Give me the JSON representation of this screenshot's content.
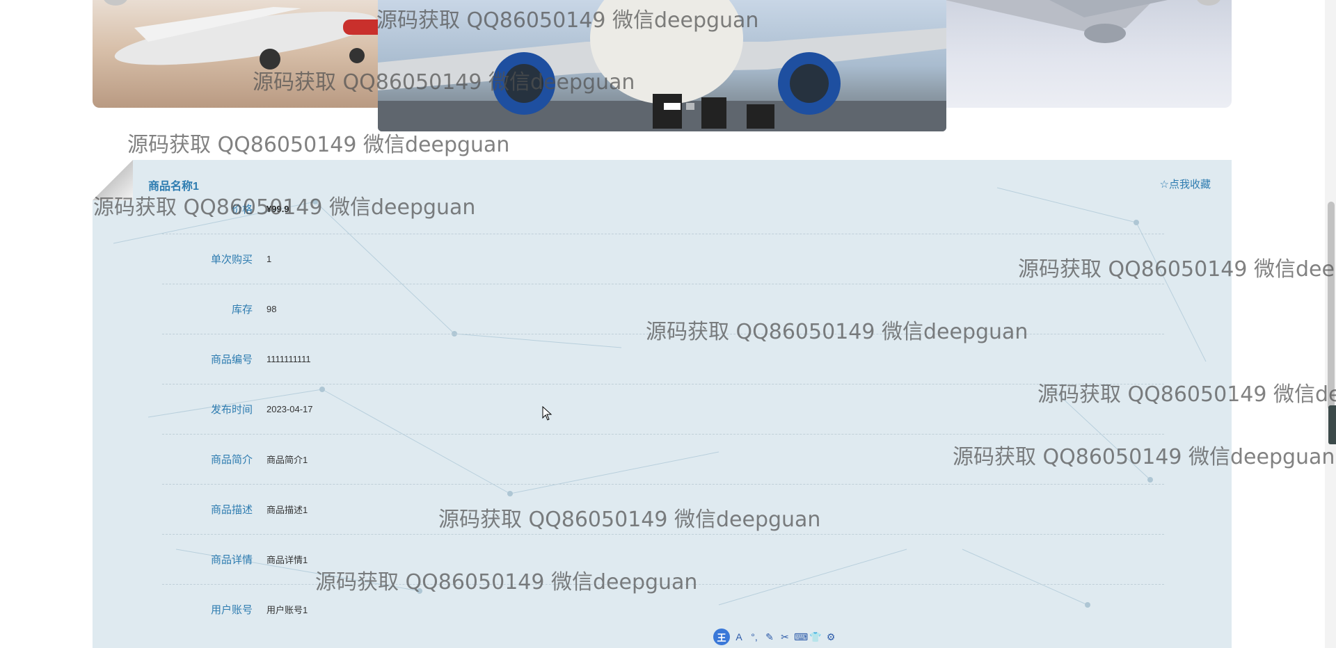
{
  "carousel": {
    "active_index": 0,
    "slide_count": 2
  },
  "product": {
    "title": "商品名称1",
    "favorite_label": "☆点我收藏",
    "fields": [
      {
        "label": "价格",
        "value": "¥99.9"
      },
      {
        "label": "单次购买",
        "value": "1"
      },
      {
        "label": "库存",
        "value": "98"
      },
      {
        "label": "商品编号",
        "value": "1111111111"
      },
      {
        "label": "发布时间",
        "value": "2023-04-17"
      },
      {
        "label": "商品简介",
        "value": "商品简介1"
      },
      {
        "label": "商品描述",
        "value": "商品描述1"
      },
      {
        "label": "商品详情",
        "value": "商品详情1"
      },
      {
        "label": "用户账号",
        "value": "用户账号1"
      }
    ]
  },
  "watermark": {
    "text_1": "源码获取 QQ86050149 微信deepguan",
    "text_2": "源码获取 QQ86050149 微信deepguan",
    "text_3": "源码获取 QQ86050149 微信deepguan",
    "text_4": "源码获取 QQ86050149 微信deepguan",
    "text_5": "源码获取 QQ86050149 微信deep",
    "text_6": "源码获取 QQ86050149 微信deepguan",
    "text_7": "源码获取 QQ86050149 微信de",
    "text_8": "源码获取 QQ86050149 微信deepguan",
    "text_9": "源码获取 QQ86050149 微信deepguan",
    "text_10": "源码获取 QQ86050149 微信deepguan"
  },
  "ime_toolbar": {
    "logo": "王",
    "buttons": [
      "A",
      "°,",
      "✎",
      "✂",
      "⌨",
      "👕",
      "⚙"
    ]
  },
  "colors": {
    "accent": "#2e7cb0",
    "panel_bg": "#dfeaf0"
  }
}
